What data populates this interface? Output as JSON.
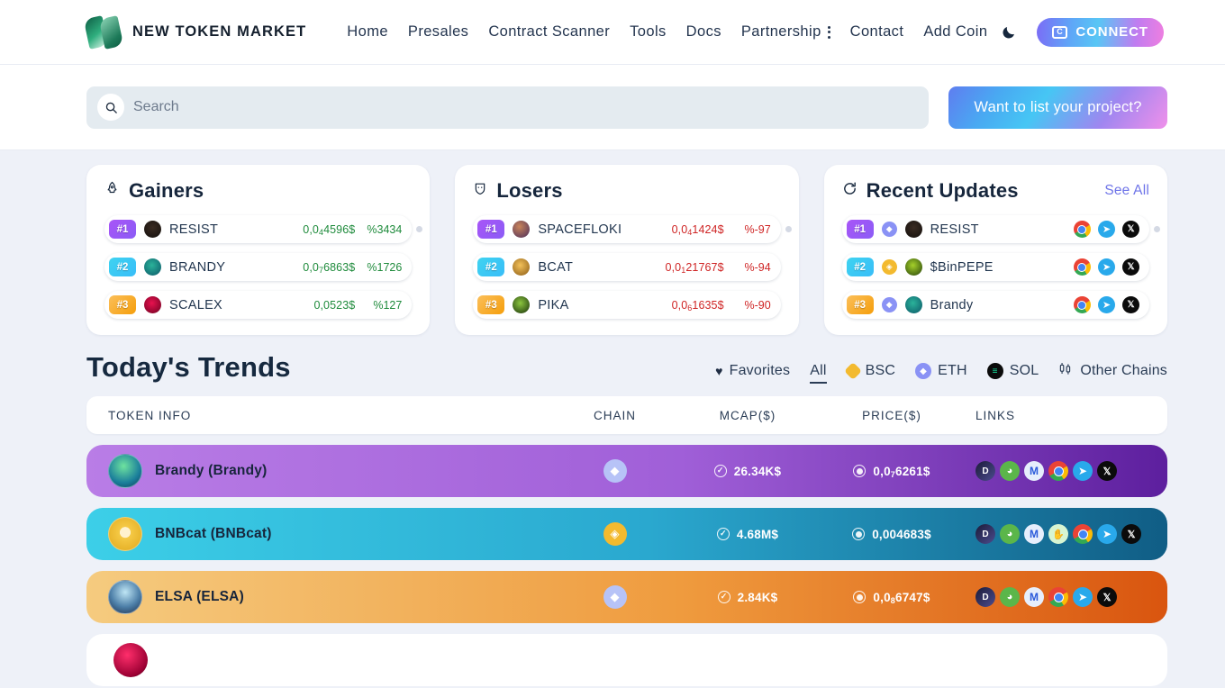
{
  "brand": {
    "name": "NEW TOKEN MARKET"
  },
  "nav": {
    "links": [
      {
        "label": "Home"
      },
      {
        "label": "Presales"
      },
      {
        "label": "Contract Scanner"
      },
      {
        "label": "Tools"
      },
      {
        "label": "Docs"
      },
      {
        "label": "Partnership",
        "has_menu": true
      },
      {
        "label": "Contact"
      },
      {
        "label": "Add Coin"
      }
    ],
    "theme_toggle_icon": "moon-icon",
    "connect_label": "CONNECT"
  },
  "search": {
    "placeholder": "Search",
    "value": "",
    "icon": "search-icon"
  },
  "cta": {
    "list_project_label": "Want to list your project?"
  },
  "gainers": {
    "title": "Gainers",
    "icon": "rocket-icon",
    "rows": [
      {
        "rank": "#1",
        "name": "RESIST",
        "price": "0,0",
        "price_sub": "4",
        "price_rest": "4596$",
        "pct": "%3434",
        "dir": "up"
      },
      {
        "rank": "#2",
        "name": "BRANDY",
        "price": "0,0",
        "price_sub": "7",
        "price_rest": "6863$",
        "pct": "%1726",
        "dir": "up"
      },
      {
        "rank": "#3",
        "name": "SCALEX",
        "price": "0,0523$",
        "price_sub": "",
        "price_rest": "",
        "pct": "%127",
        "dir": "up"
      }
    ]
  },
  "losers": {
    "title": "Losers",
    "icon": "shield-icon",
    "rows": [
      {
        "rank": "#1",
        "name": "SPACEFLOKI",
        "price": "0,0",
        "price_sub": "4",
        "price_rest": "1424$",
        "pct": "%-97",
        "dir": "down"
      },
      {
        "rank": "#2",
        "name": "BCAT",
        "price": "0,0",
        "price_sub": "1",
        "price_rest": "21767$",
        "pct": "%-94",
        "dir": "down"
      },
      {
        "rank": "#3",
        "name": "PIKA",
        "price": "0,0",
        "price_sub": "6",
        "price_rest": "1635$",
        "pct": "%-90",
        "dir": "down"
      }
    ]
  },
  "recent_updates": {
    "title": "Recent Updates",
    "icon": "refresh-icon",
    "see_all_label": "See All",
    "rows": [
      {
        "rank": "#1",
        "chain": "ETH",
        "name": "RESIST",
        "links": [
          "chrome-icon",
          "telegram-icon",
          "x-icon"
        ]
      },
      {
        "rank": "#2",
        "chain": "BSC",
        "name": "$BinPEPE",
        "links": [
          "chrome-icon",
          "telegram-icon",
          "x-icon"
        ]
      },
      {
        "rank": "#3",
        "chain": "ETH",
        "name": "Brandy",
        "links": [
          "chrome-icon",
          "telegram-icon",
          "x-icon"
        ]
      }
    ]
  },
  "trends": {
    "title": "Today's Trends",
    "filters": [
      {
        "label": "Favorites",
        "icon": "heart-icon",
        "active": false
      },
      {
        "label": "All",
        "icon": "",
        "active": true
      },
      {
        "label": "BSC",
        "icon": "bsc-icon",
        "active": false
      },
      {
        "label": "ETH",
        "icon": "eth-icon",
        "active": false
      },
      {
        "label": "SOL",
        "icon": "sol-icon",
        "active": false
      },
      {
        "label": "Other Chains",
        "icon": "chains-icon",
        "active": false
      }
    ],
    "columns": {
      "token": "TOKEN INFO",
      "chain": "CHAIN",
      "mcap": "MCAP($)",
      "price": "PRICE($)",
      "links": "LINKS"
    },
    "rows": [
      {
        "name": "Brandy (Brandy)",
        "chain": "ETH",
        "mcap": "26.34K$",
        "price_head": "0,0",
        "price_sub": "7",
        "price_tail": "6261$",
        "links": [
          "dexscreener-icon",
          "dextools-icon",
          "coinmarketcap-icon",
          "chrome-icon",
          "telegram-icon",
          "x-icon"
        ]
      },
      {
        "name": "BNBcat (BNBcat)",
        "chain": "BSC",
        "mcap": "4.68M$",
        "price_head": "0,004683$",
        "price_sub": "",
        "price_tail": "",
        "links": [
          "dexscreener-icon",
          "dextools-icon",
          "coinmarketcap-icon",
          "pinksale-icon",
          "chrome-icon",
          "telegram-icon",
          "x-icon"
        ]
      },
      {
        "name": "ELSA (ELSA)",
        "chain": "ETH",
        "mcap": "2.84K$",
        "price_head": "0,0",
        "price_sub": "8",
        "price_tail": "6747$",
        "links": [
          "dexscreener-icon",
          "dextools-icon",
          "coinmarketcap-icon",
          "chrome-icon",
          "telegram-icon",
          "x-icon"
        ]
      }
    ]
  },
  "colors": {
    "page_bg": "#eef1f8",
    "accent_purple": "#6e74e8",
    "up_green": "#1f8b3c",
    "down_red": "#cf2424"
  }
}
